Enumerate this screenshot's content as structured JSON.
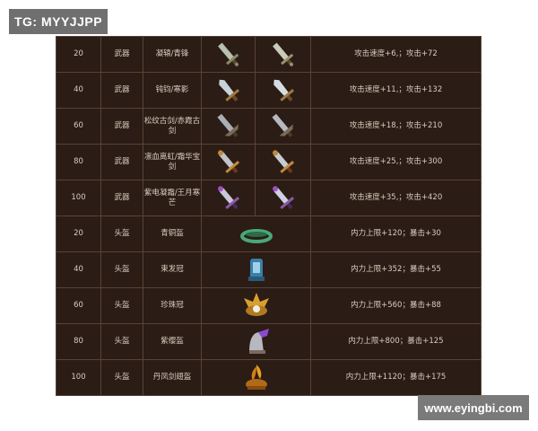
{
  "overlay": {
    "tg_label": "TG: MYYJJPP",
    "site_label": "www.eyingbi.com"
  },
  "colors": {
    "table_bg": "#2b1c15",
    "border": "#5a4334",
    "weapon_type_bg": "#f2e1e1",
    "helmet_type_bg": "#e5efd6"
  },
  "rows": [
    {
      "level": "20",
      "type": "武器",
      "name": "凝辕/青锋",
      "icon": "sword-icon",
      "stats": "攻击速度+6,；攻击+72"
    },
    {
      "level": "40",
      "type": "武器",
      "name": "钝钧/寒影",
      "icon": "sword-icon",
      "stats": "攻击速度+11,；攻击+132"
    },
    {
      "level": "60",
      "type": "武器",
      "name": "松纹古剑/赤霞古剑",
      "icon": "sword-icon",
      "stats": "攻击速度+18,；攻击+210"
    },
    {
      "level": "80",
      "type": "武器",
      "name": "凛血离虹/霜华宝剑",
      "icon": "sword-icon",
      "stats": "攻击速度+25,；攻击+300"
    },
    {
      "level": "100",
      "type": "武器",
      "name": "紫电凝霜/王月寒芒",
      "icon": "sword-icon",
      "stats": "攻击速度+35,；攻击+420"
    },
    {
      "level": "20",
      "type": "头盔",
      "name": "青铜盔",
      "icon": "bronze-helmet-icon",
      "stats": "内力上限+120；暴击+30"
    },
    {
      "level": "40",
      "type": "头盔",
      "name": "束发冠",
      "icon": "hair-crown-icon",
      "stats": "内力上限+352；暴击+55"
    },
    {
      "level": "60",
      "type": "头盔",
      "name": "珍珠冠",
      "icon": "pearl-crown-icon",
      "stats": "内力上限+560；暴击+88"
    },
    {
      "level": "80",
      "type": "头盔",
      "name": "紫缨盔",
      "icon": "purple-helmet-icon",
      "stats": "内力上限+800；暴击+125"
    },
    {
      "level": "100",
      "type": "头盔",
      "name": "丹凤剑翅盔",
      "icon": "phoenix-helmet-icon",
      "stats": "内力上限+1120；暴击+175"
    }
  ]
}
